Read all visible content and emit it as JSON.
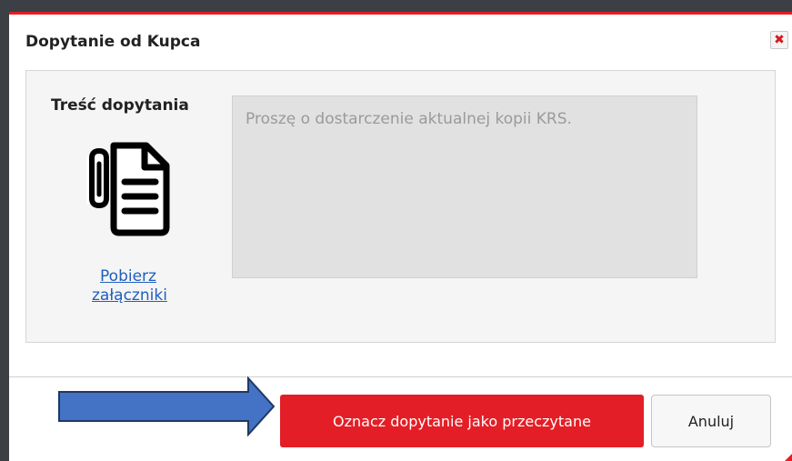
{
  "dialog": {
    "title": "Dopytanie od Kupca",
    "close_icon": "close-icon",
    "field_label": "Treść dopytania",
    "attachment_icon": "document-attachment-icon",
    "download_link": "Pobierz załączniki",
    "question_text": "Proszę o dostarczenie aktualnej kopii KRS."
  },
  "actions": {
    "mark_read_label": "Oznacz dopytanie jako przeczytane",
    "cancel_label": "Anuluj"
  },
  "annotation": {
    "arrow_icon": "arrow-right-icon"
  },
  "colors": {
    "accent": "#e41e26",
    "link": "#1f5fbf",
    "arrow": "#4472c4"
  }
}
